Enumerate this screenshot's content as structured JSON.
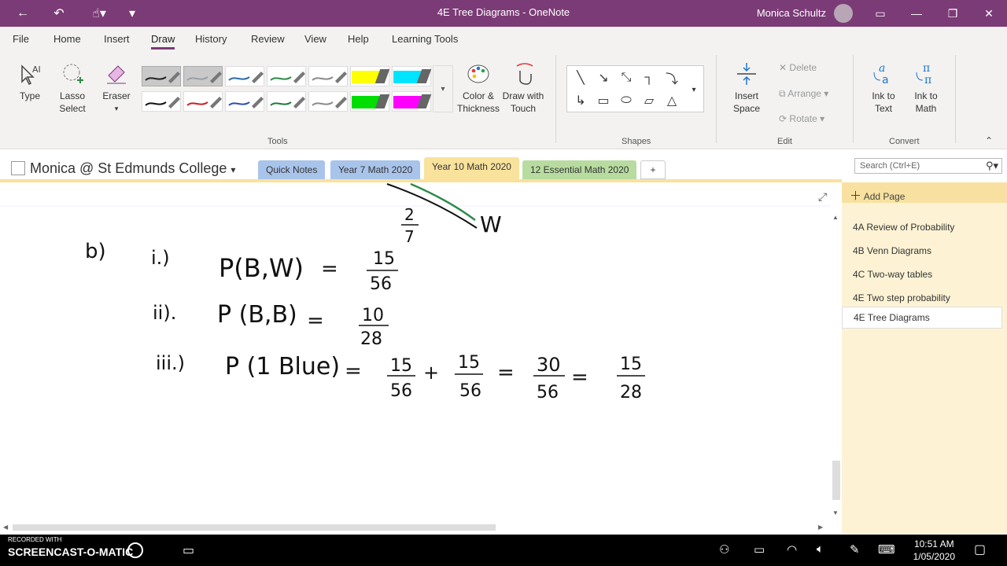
{
  "window": {
    "title": "4E Tree Diagrams - OneNote",
    "user": "Monica Schultz"
  },
  "menu": {
    "items": [
      "File",
      "Home",
      "Insert",
      "Draw",
      "History",
      "Review",
      "View",
      "Help",
      "Learning Tools"
    ],
    "active": "Draw"
  },
  "ribbon": {
    "tools": {
      "type_label": "Type",
      "lasso_label": "Lasso Select",
      "eraser_label": "Eraser",
      "color_label": "Color & Thickness",
      "draw_touch_label": "Draw with Touch",
      "group_label": "Tools"
    },
    "shapes": {
      "group_label": "Shapes"
    },
    "edit": {
      "insert_space_label": "Insert Space",
      "delete_label": "Delete",
      "arrange_label": "Arrange",
      "rotate_label": "Rotate",
      "group_label": "Edit"
    },
    "convert": {
      "ink_to_text_label": "Ink to Text",
      "ink_to_math_label": "Ink to Math",
      "group_label": "Convert"
    },
    "pen_colors": [
      "#222222",
      "#9aa0a8",
      "#2b6cb0",
      "#2f8a4a",
      "#8a8a8a",
      "#ffff00",
      "#00e5ff",
      "#111111",
      "#cc2222",
      "#2b4fb0",
      "#1f7a3a",
      "#8a8a8a",
      "#00dd00",
      "#ff00ff"
    ]
  },
  "notebook": {
    "name": "Monica @ St Edmunds College",
    "tabs": [
      {
        "label": "Quick Notes",
        "color": "#a9c4ea"
      },
      {
        "label": "Year 7 Math 2020",
        "color": "#a9c4ea"
      },
      {
        "label": "Year 10 Math 2020",
        "color": "#f9e29c",
        "active": true
      },
      {
        "label": "12 Essential Math 2020",
        "color": "#b8dca0"
      }
    ],
    "add_tab": "+",
    "search_placeholder": "Search (Ctrl+E)"
  },
  "pages": {
    "add_label": "Add Page",
    "items": [
      "4A Review of Probability",
      "4B Venn Diagrams",
      "4C Two-way tables",
      "4E Two step probability",
      "4E Tree Diagrams"
    ],
    "selected": "4E Tree Diagrams"
  },
  "canvas": {
    "part": "b)",
    "tree_fraction_num": "2",
    "tree_fraction_den": "7",
    "tree_leaf": "W",
    "lines": [
      {
        "num": "i.)",
        "expr": "P(B,W)",
        "eq": "=",
        "num1": "15",
        "den1": "56"
      },
      {
        "num": "ii).",
        "expr": "P (B,B)",
        "eq": "=",
        "num1": "10",
        "den1": "28"
      },
      {
        "num": "iii.)",
        "expr": "P (1 Blue)",
        "eq": "=",
        "num1": "15",
        "den1": "56",
        "op": "+",
        "num2": "15",
        "den2": "56",
        "eq2": "=",
        "num3": "30",
        "den3": "56",
        "eq3": "=",
        "num4": "15",
        "den4": "28"
      }
    ]
  },
  "taskbar": {
    "recorder": "SCREENCAST-O-MATIC",
    "recorded_with": "RECORDED WITH",
    "time": "10:51 AM",
    "date": "1/05/2020"
  }
}
